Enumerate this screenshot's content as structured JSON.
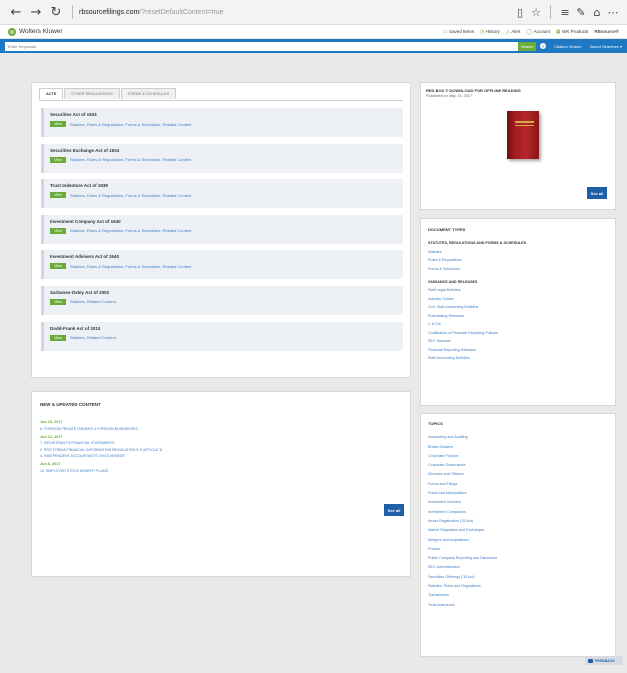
{
  "browser": {
    "url_main": "rbsourcefilings.com",
    "url_rest": "/?resetDefaultContent=true"
  },
  "header": {
    "brand": "Wolters Kluwer",
    "links": [
      "Saved Items",
      "History",
      "Alert",
      "Account",
      "WK Products"
    ],
    "product": "RBsource®"
  },
  "search": {
    "placeholder": "Enter Keywords",
    "button": "Search",
    "help": "?",
    "citation": "Citation Search",
    "saved": "Saved Searches ▾"
  },
  "tabs": [
    "Acts",
    "Other Regulations",
    "Forms & Schedules"
  ],
  "view_label": "View",
  "acts": [
    {
      "name": "Securities Act of 1933",
      "links": "Statutes, Rules & Regulations, Forms & Schedules, Related Content"
    },
    {
      "name": "Securities Exchange Act of 1934",
      "links": "Statutes, Rules & Regulations, Forms & Schedules, Related Content"
    },
    {
      "name": "Trust Indenture Act of 1939",
      "links": "Statutes, Rules & Regulations, Forms & Schedules, Related Content"
    },
    {
      "name": "Investment Company Act of 1940",
      "links": "Statutes, Rules & Regulations, Forms & Schedules, Related Content"
    },
    {
      "name": "Investment Advisers Act of 1940",
      "links": "Statutes, Rules & Regulations, Forms & Schedules, Related Content"
    },
    {
      "name": "Sarbanes-Oxley Act of 2002",
      "links": "Statutes, Related Content"
    },
    {
      "name": "Dodd-Frank Act of 2010",
      "links": "Statutes, Related Content"
    }
  ],
  "updates": {
    "title": "New & Updated Content",
    "groups": [
      {
        "date": "Jun 15, 2017",
        "items": [
          "6. Foreign Private Issuers & Foreign Businesses"
        ]
      },
      {
        "date": "Jun 12, 2017",
        "items": [
          "7. Registrant's Financial Statements",
          "2. Pro Forma Financial Information Regulation S-X Article 11",
          "4. Independent Accountants' Involvement"
        ]
      },
      {
        "date": "Jun 8, 2017",
        "items": [
          "10. Employee Stock Benefit Plans"
        ]
      }
    ],
    "see_all": "See all"
  },
  "redbox": {
    "title": "Red Box ® Download for Offline Reading",
    "published": "Published on May 15, 2017",
    "see_all": "See all"
  },
  "doctypes": {
    "title": "Document Types",
    "sections": [
      {
        "heading": "Statutes, Regulations and Forms & Schedules",
        "items": [
          "Statutes",
          "Rules & Regulations",
          "Forms & Schedules"
        ]
      },
      {
        "heading": "Guidance and Releases",
        "items": [
          "Staff Legal Bulletins",
          "Industry Guides",
          "Cod. Staff Accounting Bulletins",
          "Rulemaking Releases",
          "C & DIs",
          "Codification of Financial Reporting Policies",
          "SEC Manuals",
          "Financial Reporting Releases",
          "Staff Accounting Bulletins"
        ]
      }
    ]
  },
  "topics": {
    "title": "Topics",
    "items": [
      "Accounting and Auditing",
      "Broker-Dealers",
      "Corporate Finance",
      "Corporate Governance",
      "Directors and Officers",
      "Forms and Filings",
      "Fraud and Manipulation",
      "Investment Advisers",
      "Investment Companies",
      "Issuer Registration ('33 Act)",
      "Market Regulation and Exchanges",
      "Mergers and Acquisitions",
      "Proxies",
      "Public Company Reporting and Disclosure",
      "SEC Administration",
      "Securities Offerings ('33 Act)",
      "Statutes, Rules and Regulations",
      "Transactions",
      "Trust Indentures"
    ]
  },
  "feedback": "Feedback"
}
